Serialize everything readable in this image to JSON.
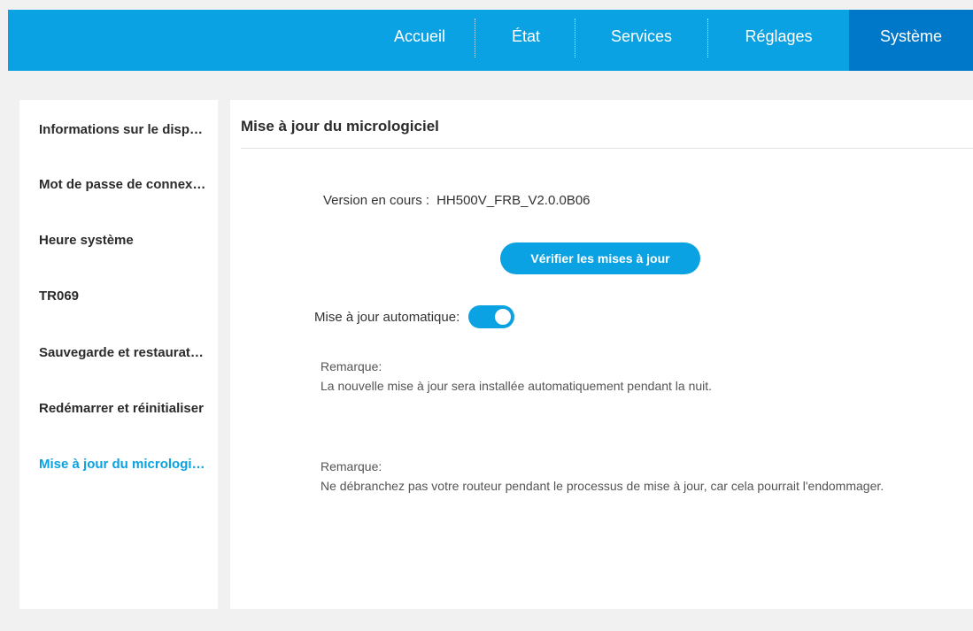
{
  "nav": {
    "items": [
      {
        "label": "Accueil"
      },
      {
        "label": "État"
      },
      {
        "label": "Services"
      },
      {
        "label": "Réglages"
      },
      {
        "label": "Système",
        "active": true
      }
    ]
  },
  "sidebar": {
    "items": [
      {
        "label": "Informations sur le dispositif"
      },
      {
        "label": "Mot de passe de connexion"
      },
      {
        "label": "Heure système"
      },
      {
        "label": "TR069"
      },
      {
        "label": "Sauvegarde et restauration"
      },
      {
        "label": "Redémarrer et réinitialiser"
      },
      {
        "label": "Mise à jour du micrologiciel",
        "active": true
      }
    ]
  },
  "main": {
    "title": "Mise à jour du micrologiciel",
    "version_label": "Version en cours :",
    "version_value": "HH500V_FRB_V2.0.0B06",
    "check_button": "Vérifier les mises à jour",
    "auto_update_label": "Mise à jour automatique:",
    "auto_update_on": true,
    "note1_title": "Remarque:",
    "note1_text": "La nouvelle mise à jour sera installée automatiquement pendant la nuit.",
    "note2_title": "Remarque:",
    "note2_text": "Ne débranchez pas votre routeur pendant le processus de mise à jour, car cela pourrait l'endommager."
  },
  "colors": {
    "accent": "#0aa2e2",
    "nav_active": "#0078c9"
  }
}
